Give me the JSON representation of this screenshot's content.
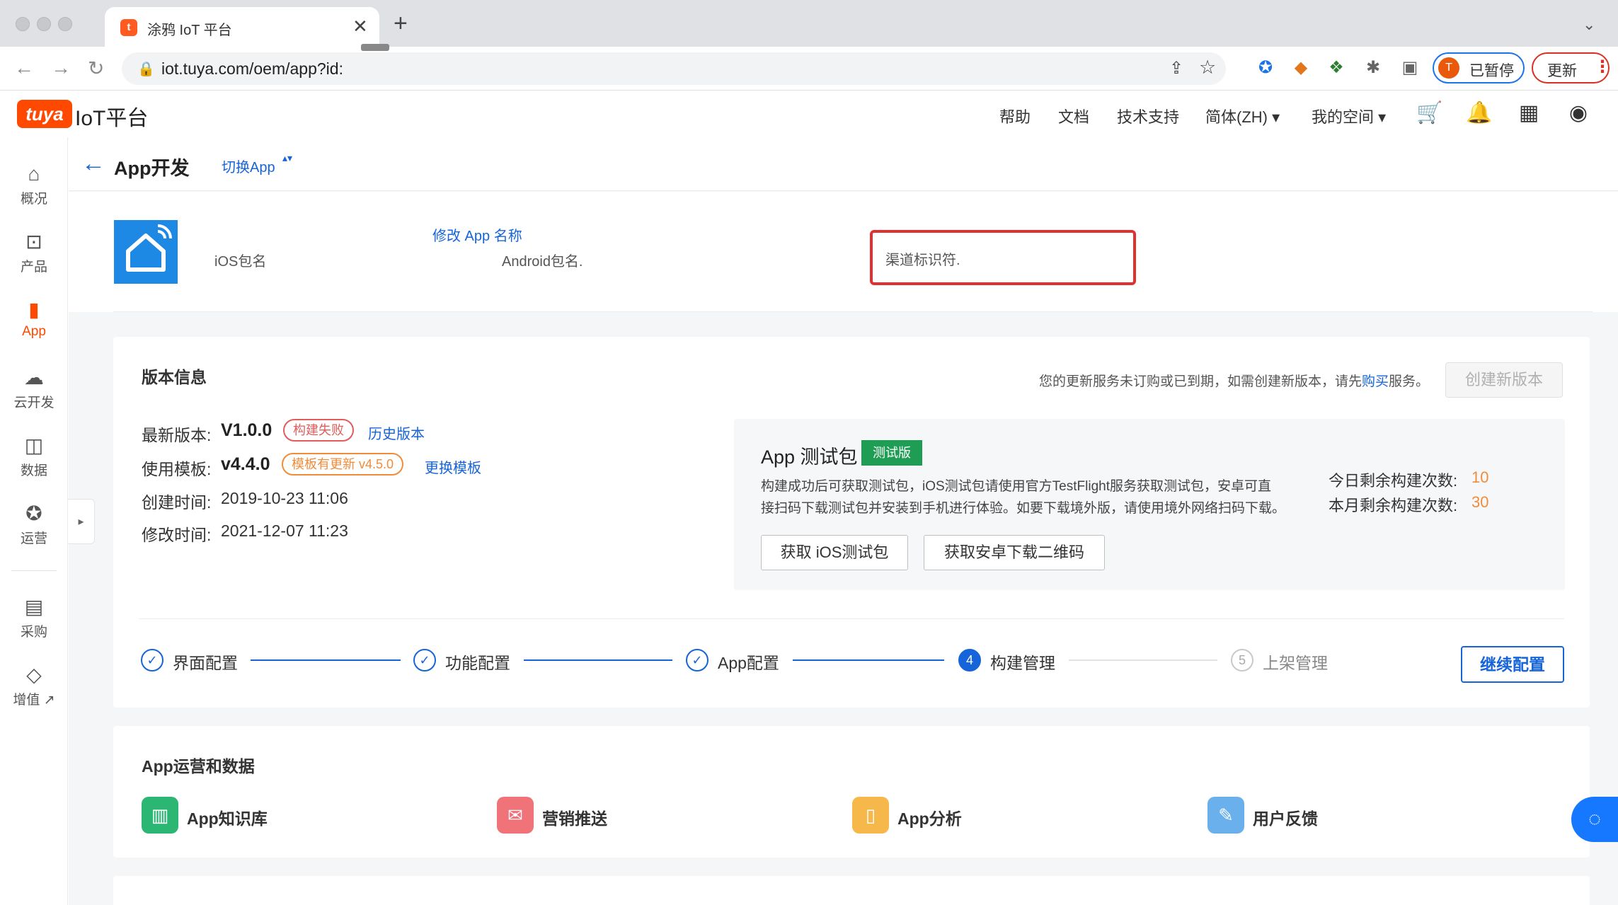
{
  "browser": {
    "tab_title": "涂鸦 IoT 平台",
    "favicon_letter": "t",
    "close_glyph": "✕",
    "new_tab_glyph": "+",
    "tabs_menu_glyph": "⌄",
    "url": "iot.tuya.com/oem/app?id:",
    "profile_initial": "T",
    "paused_label": "已暂停",
    "update_label": "更新",
    "menu_glyph": "⋮",
    "nav_back_glyph": "←",
    "nav_forward_glyph": "→",
    "reload_glyph": "↻",
    "lock_glyph": "🔒",
    "share_glyph": "⇪",
    "star_glyph": "☆",
    "puzzle_glyph": "✱",
    "sidepanel_glyph": "▣"
  },
  "header": {
    "logo_badge": "tuya",
    "logo_text": "IoT平台",
    "nav": [
      "帮助",
      "文档",
      "技术支持",
      "简体(ZH) ▾",
      "我的空间 ▾"
    ],
    "icons": [
      "cart-icon",
      "bell-icon",
      "apps-grid-icon",
      "user-icon"
    ],
    "cart_glyph": "🛒",
    "bell_glyph": "🔔",
    "grid_glyph": "▦",
    "user_glyph": "◉"
  },
  "sidebar": {
    "items": [
      {
        "label": "概况",
        "icon": "home-icon",
        "glyph": "⌂"
      },
      {
        "label": "产品",
        "icon": "terminal-icon",
        "glyph": "⊡"
      },
      {
        "label": "App",
        "icon": "phone-icon",
        "glyph": "▮"
      },
      {
        "label": "云开发",
        "icon": "cloud-icon",
        "glyph": "☁"
      },
      {
        "label": "数据",
        "icon": "chart-icon",
        "glyph": "◫"
      },
      {
        "label": "运营",
        "icon": "ribbon-icon",
        "glyph": "✪"
      },
      {
        "label": "采购",
        "icon": "store-icon",
        "glyph": "▤"
      },
      {
        "label": "增值 ↗",
        "icon": "diamond-icon",
        "glyph": "◇"
      }
    ],
    "collapse_glyph": "▸"
  },
  "page": {
    "back_glyph": "←",
    "title": "App开发",
    "switch_label": "切换App",
    "switch_caret": "▴▾"
  },
  "app_info": {
    "ios_label": "iOS包名",
    "rename_link": "修改 App 名称",
    "android_label": "Android包名.",
    "channel_label": "渠道标识符."
  },
  "version": {
    "section_title": "版本信息",
    "notice_prefix": "您的更新服务未订购或已到期，如需创建新版本，请先",
    "notice_link": "购买",
    "notice_suffix": "服务。",
    "create_button": "创建新版本",
    "latest_label": "最新版本:",
    "latest_value": "V1.0.0",
    "build_status": "构建失败",
    "history_link": "历史版本",
    "template_label": "使用模板:",
    "template_value": "v4.4.0",
    "template_update": "模板有更新 v4.5.0",
    "change_template_link": "更换模板",
    "created_label": "创建时间:",
    "created_value": "2019-10-23 11:06",
    "modified_label": "修改时间:",
    "modified_value": "2021-12-07 11:23"
  },
  "test_package": {
    "title": "App 测试包",
    "badge": "测试版",
    "desc_line1": "构建成功后可获取测试包，iOS测试包请使用官方TestFlight服务获取测试包，安卓可直",
    "desc_line2": "接扫码下载测试包并安装到手机进行体验。如要下载境外版，请使用境外网络扫码下载。",
    "daily_label": "今日剩余构建次数:",
    "daily_value": "10",
    "monthly_label": "本月剩余构建次数:",
    "monthly_value": "30",
    "ios_button": "获取 iOS测试包",
    "android_button": "获取安卓下载二维码"
  },
  "steps": {
    "items": [
      {
        "label": "界面配置",
        "state": "done",
        "mark": "✓"
      },
      {
        "label": "功能配置",
        "state": "done",
        "mark": "✓"
      },
      {
        "label": "App配置",
        "state": "done",
        "mark": "✓"
      },
      {
        "label": "构建管理",
        "state": "current",
        "mark": "4"
      },
      {
        "label": "上架管理",
        "state": "pending",
        "mark": "5"
      }
    ],
    "continue_button": "继续配置"
  },
  "operations": {
    "section_title": "App运营和数据",
    "tools": [
      {
        "label": "App知识库",
        "icon": "book-icon",
        "glyph": "▥",
        "color": "#2bb673"
      },
      {
        "label": "营销推送",
        "icon": "mail-icon",
        "glyph": "✉",
        "color": "#f0737a"
      },
      {
        "label": "App分析",
        "icon": "phone-chart-icon",
        "glyph": "▯",
        "color": "#f7b84b"
      },
      {
        "label": "用户反馈",
        "icon": "feedback-icon",
        "glyph": "✎",
        "color": "#6ab0ec"
      }
    ]
  },
  "chat_glyph": "◌",
  "colors": {
    "brand": "#ff4800",
    "primary": "#1664d9",
    "error": "#e03030",
    "success": "#1f9d55",
    "warning": "#f08c3a"
  }
}
